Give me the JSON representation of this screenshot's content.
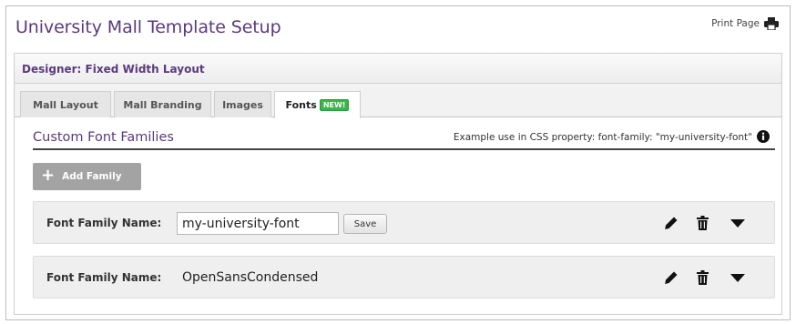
{
  "page": {
    "title": "University Mall Template Setup",
    "print_label": "Print Page",
    "print_icon": "printer-icon"
  },
  "panel": {
    "header": "Designer: Fixed Width Layout",
    "tabs": [
      {
        "label": "Mall Layout",
        "active": false
      },
      {
        "label": "Mall Branding",
        "active": false
      },
      {
        "label": "Images",
        "active": false
      },
      {
        "label": "Fonts",
        "active": true,
        "badge": "NEW!"
      }
    ]
  },
  "section": {
    "title": "Custom Font Families",
    "example": "Example use in CSS property: font-family: \"my-university-font\"",
    "info_icon": "info-circle-icon"
  },
  "add_button": {
    "label": "Add Family",
    "icon": "plus-icon"
  },
  "families": [
    {
      "label": "Font Family Name:",
      "editing": true,
      "value": "my-university-font",
      "save_label": "Save",
      "icons": [
        "pencil-icon",
        "trash-icon",
        "caret-down-icon"
      ]
    },
    {
      "label": "Font Family Name:",
      "editing": false,
      "value": "OpenSansCondensed",
      "icons": [
        "pencil-icon",
        "trash-icon",
        "caret-down-icon"
      ]
    }
  ],
  "colors": {
    "title_purple": "#5b3a7e",
    "badge_green": "#39b54a",
    "add_button_gray": "#a3a3a3",
    "row_background": "#efefef"
  }
}
